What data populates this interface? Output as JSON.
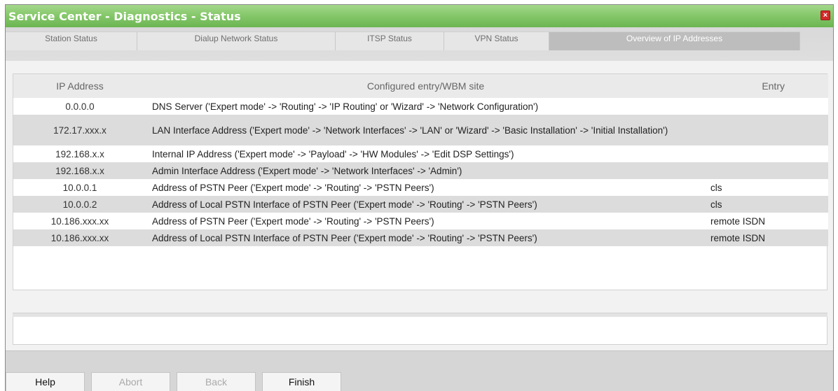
{
  "window": {
    "title": "Service Center - Diagnostics - Status",
    "close_glyph": "×"
  },
  "tabs": [
    {
      "label": "Station Status",
      "active": false
    },
    {
      "label": "Dialup Network Status",
      "active": false
    },
    {
      "label": "ITSP Status",
      "active": false
    },
    {
      "label": "VPN Status",
      "active": false
    },
    {
      "label": "Overview of IP Addresses",
      "active": true
    }
  ],
  "table": {
    "headers": {
      "ip": "IP Address",
      "entry_site": "Configured entry/WBM site",
      "entry": "Entry"
    },
    "rows": [
      {
        "ip": "0.0.0.0",
        "desc": "DNS Server ('Expert mode' -> 'Routing' -> 'IP Routing' or 'Wizard' -> 'Network Configuration')",
        "entry": ""
      },
      {
        "ip": "172.17.xxx.x",
        "desc": "LAN Interface Address ('Expert mode' -> 'Network Interfaces' -> 'LAN' or 'Wizard' -> 'Basic Installation' -> 'Initial Installation')",
        "entry": ""
      },
      {
        "ip": "192.168.x.x",
        "desc": "Internal IP Address ('Expert mode' -> 'Payload' -> 'HW Modules' -> 'Edit DSP Settings')",
        "entry": ""
      },
      {
        "ip": "192.168.x.x",
        "desc": "Admin Interface Address ('Expert mode' -> 'Network Interfaces' -> 'Admin')",
        "entry": ""
      },
      {
        "ip": "10.0.0.1",
        "desc": "Address of PSTN Peer ('Expert mode' -> 'Routing' -> 'PSTN Peers')",
        "entry": "cls"
      },
      {
        "ip": "10.0.0.2",
        "desc": "Address of Local PSTN Interface of PSTN Peer ('Expert mode' -> 'Routing' -> 'PSTN Peers')",
        "entry": "cls"
      },
      {
        "ip": "10.186.xxx.xx",
        "desc": "Address of PSTN Peer ('Expert mode' -> 'Routing' -> 'PSTN Peers')",
        "entry": "remote ISDN"
      },
      {
        "ip": "10.186.xxx.xx",
        "desc": "Address of Local PSTN Interface of PSTN Peer ('Expert mode' -> 'Routing' -> 'PSTN Peers')",
        "entry": "remote ISDN"
      }
    ]
  },
  "footer": {
    "help": "Help",
    "abort": "Abort",
    "back": "Back",
    "finish": "Finish"
  },
  "colors": {
    "title_bar": "#86c86b",
    "close_button": "#d42a2a",
    "active_tab": "#bdbdbd",
    "row_alt": "#dcdcdc"
  }
}
